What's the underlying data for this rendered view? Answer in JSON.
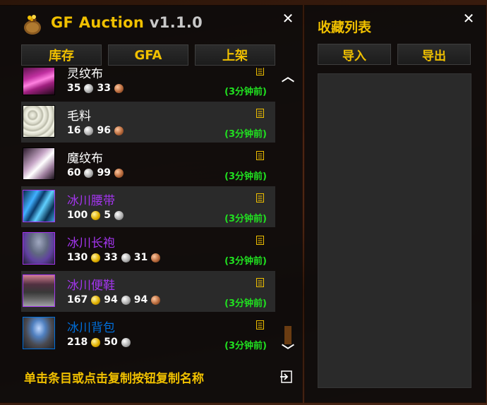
{
  "app": {
    "title": "GF Auction",
    "version": "v1.1.0"
  },
  "tabs": [
    {
      "label": "库存"
    },
    {
      "label": "GFA"
    },
    {
      "label": "上架"
    }
  ],
  "items": [
    {
      "name": "灵纹布",
      "color": "#ffffff",
      "price": {
        "silver": "35",
        "copper": "33"
      },
      "time": "(3分钟前)",
      "icon": "pink-cloth-icon"
    },
    {
      "name": "毛料",
      "color": "#ffffff",
      "price": {
        "silver": "16",
        "copper": "96"
      },
      "time": "(3分钟前)",
      "icon": "wool-icon"
    },
    {
      "name": "魔纹布",
      "color": "#ffffff",
      "price": {
        "silver": "60",
        "copper": "99"
      },
      "time": "(3分钟前)",
      "icon": "mageweave-icon"
    },
    {
      "name": "冰川腰带",
      "color": "#a335ee",
      "price": {
        "gold": "100",
        "silver": "5"
      },
      "time": "(3分钟前)",
      "icon": "belt-icon"
    },
    {
      "name": "冰川长袍",
      "color": "#a335ee",
      "price": {
        "gold": "130",
        "silver": "33",
        "copper": "31"
      },
      "time": "(3分钟前)",
      "icon": "robe-icon"
    },
    {
      "name": "冰川便鞋",
      "color": "#a335ee",
      "price": {
        "gold": "167",
        "silver": "94",
        "copper": "94"
      },
      "time": "(3分钟前)",
      "icon": "slippers-icon"
    },
    {
      "name": "冰川背包",
      "color": "#0070dd",
      "price": {
        "gold": "218",
        "silver": "50"
      },
      "time": "(3分钟前)",
      "icon": "bag-icon"
    }
  ],
  "footer": {
    "hint": "单击条目或点击复制按钮复制名称"
  },
  "favorites": {
    "title": "收藏列表",
    "import_label": "导入",
    "export_label": "导出"
  },
  "colors": {
    "accent": "#f0c000",
    "epic": "#a335ee",
    "rare": "#0070dd",
    "time": "#20e020"
  }
}
